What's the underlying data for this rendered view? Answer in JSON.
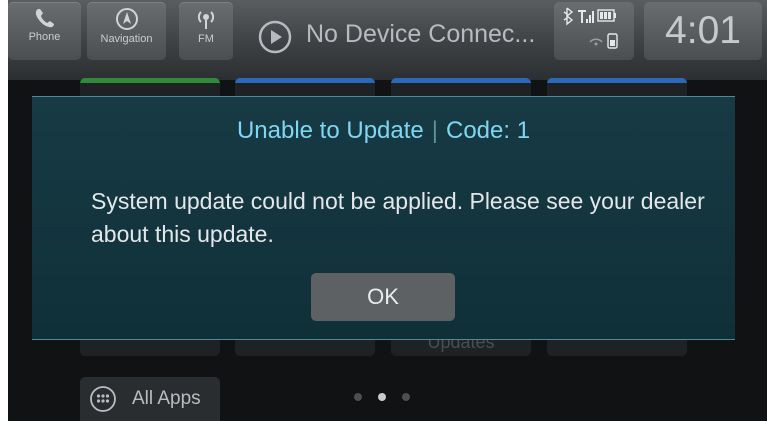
{
  "status_bar": {
    "phone_label": "Phone",
    "navigation_label": "Navigation",
    "fm_label": "FM",
    "now_playing": "No Device Connec...",
    "clock": "4:01"
  },
  "home": {
    "tile_b3_label": "Updates",
    "all_apps_label": "All Apps",
    "page_dots": 3,
    "active_page": 2
  },
  "dialog": {
    "title": "Unable to Update",
    "separator": "|",
    "code": "Code: 1",
    "message": "System update could not be applied. Please see your dealer about this update.",
    "ok_label": "OK"
  },
  "colors": {
    "dialog_bg": "#173a44",
    "title_text": "#7fd6f2",
    "nav_tile_accent": "#2c68b8",
    "phone_tile_accent": "#2f8a3a"
  }
}
